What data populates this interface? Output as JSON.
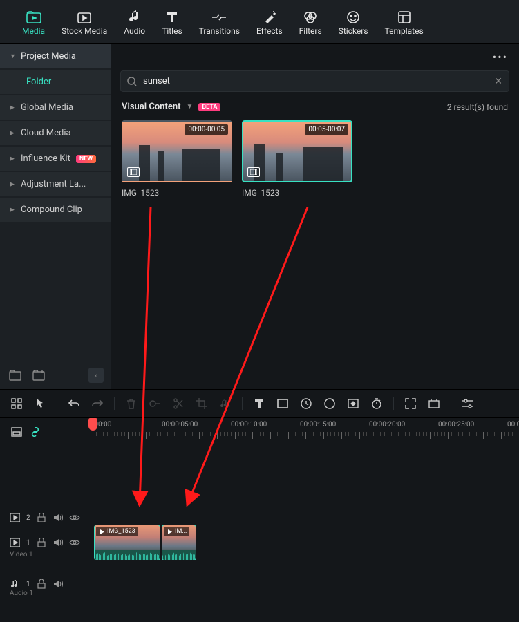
{
  "tabs": [
    {
      "label": "Media"
    },
    {
      "label": "Stock Media"
    },
    {
      "label": "Audio"
    },
    {
      "label": "Titles"
    },
    {
      "label": "Transitions"
    },
    {
      "label": "Effects"
    },
    {
      "label": "Filters"
    },
    {
      "label": "Stickers"
    },
    {
      "label": "Templates"
    }
  ],
  "sidebar": {
    "items": [
      {
        "label": "Project Media",
        "expanded": true
      },
      {
        "label": "Folder",
        "child": true
      },
      {
        "label": "Global Media"
      },
      {
        "label": "Cloud Media"
      },
      {
        "label": "Influence Kit",
        "badge": "NEW"
      },
      {
        "label": "Adjustment La..."
      },
      {
        "label": "Compound Clip"
      }
    ]
  },
  "search": {
    "value": "sunset"
  },
  "results": {
    "heading": "Visual Content",
    "beta": "BETA",
    "found": "2 result(s) found",
    "thumbs": [
      {
        "tc": "00:00-00:05",
        "label": "IMG_1523",
        "sel": false
      },
      {
        "tc": "00:05-00:07",
        "label": "IMG_1523",
        "sel": true
      }
    ]
  },
  "ruler": [
    ":00:00",
    "00:00:05:00",
    "00:00:10:00",
    "00:00:15:00",
    "00:00:20:00",
    "00:00:25:00",
    "00:0"
  ],
  "tracks": {
    "video1": "Video 1",
    "audio1": "Audio 1",
    "clips": [
      {
        "label": "IMG_1523"
      },
      {
        "label": "IM..."
      }
    ]
  }
}
